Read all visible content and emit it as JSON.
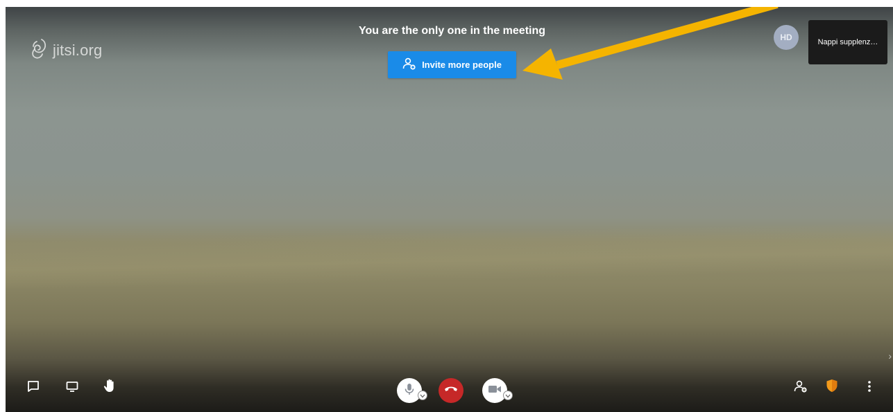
{
  "branding": {
    "logo_text": "jitsi.org"
  },
  "meeting": {
    "notice": "You are the only one in the meeting",
    "invite_button_label": "Invite more people"
  },
  "participant": {
    "avatar_initials": "HD",
    "thumbnail_name": "Nappi supplenz…"
  },
  "colors": {
    "invite_button": "#1a8be8",
    "hangup_button": "#c62828",
    "security_shield": "#f39a1b",
    "annotation_arrow": "#f5b400"
  },
  "toolbar": {
    "left_icons": [
      "chat-icon",
      "screen-share-icon",
      "raise-hand-icon"
    ],
    "center_icons": [
      "microphone-icon",
      "hangup-icon",
      "camera-icon"
    ],
    "right_icons": [
      "invite-people-icon",
      "security-shield-icon",
      "more-options-icon"
    ]
  }
}
